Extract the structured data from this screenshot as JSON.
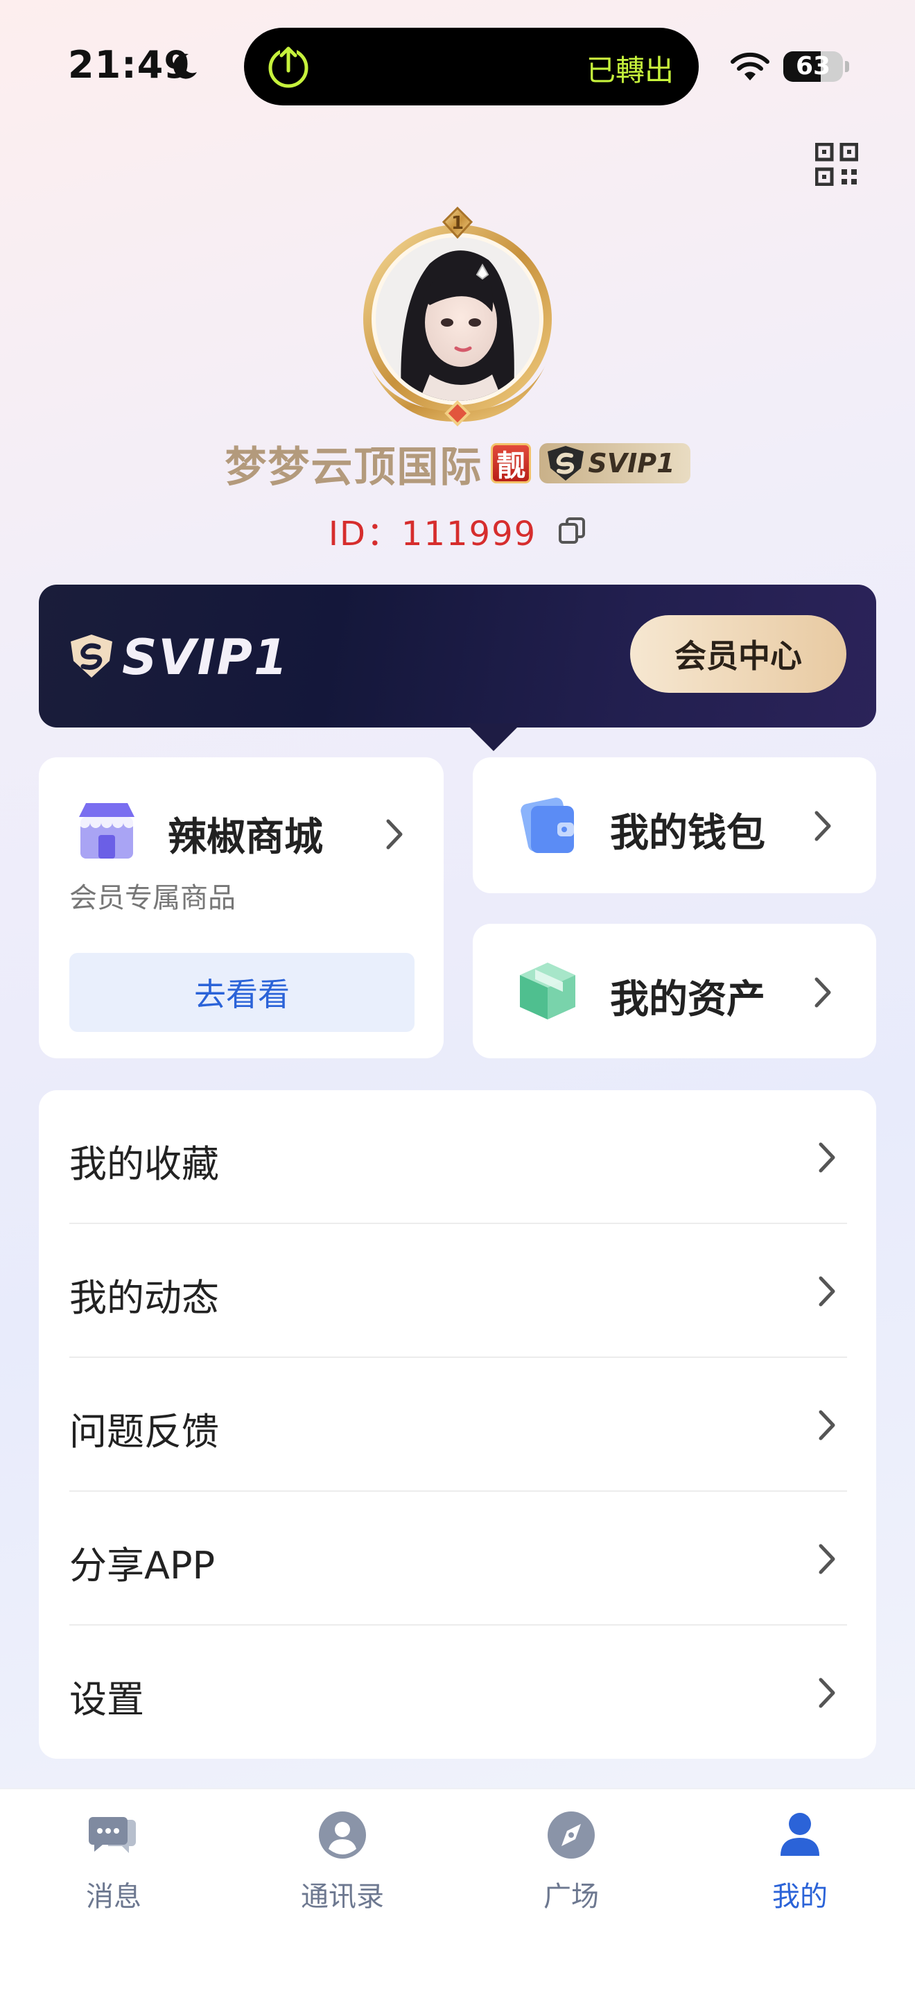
{
  "status_bar": {
    "time": "21:49",
    "island_text": "已轉出",
    "battery_level": "63",
    "battery_fraction": 0.63
  },
  "profile": {
    "avatar_level": "1",
    "nickname": "梦梦云顶国际",
    "pretty_badge": "靓",
    "svip_tag": "SVIP1",
    "id_text": "ID：111999"
  },
  "banner": {
    "title": "SVIP1",
    "vip_center_label": "会员中心"
  },
  "shop": {
    "title": "辣椒商城",
    "subtitle": "会员专属商品",
    "go_label": "去看看"
  },
  "wallet": {
    "title": "我的钱包"
  },
  "assets": {
    "title": "我的资产"
  },
  "menu": {
    "items": [
      {
        "label": "我的收藏"
      },
      {
        "label": "我的动态"
      },
      {
        "label": "问题反馈"
      },
      {
        "label": "分享APP"
      },
      {
        "label": "设置"
      }
    ]
  },
  "tabs": [
    {
      "label": "消息",
      "icon": "chat-icon"
    },
    {
      "label": "通讯录",
      "icon": "contacts-icon"
    },
    {
      "label": "广场",
      "icon": "compass-icon"
    },
    {
      "label": "我的",
      "icon": "person-icon",
      "active": true
    }
  ],
  "colors": {
    "accent": "#2b63d8",
    "id_red": "#d62d2d",
    "banner_dark": "#14173a",
    "gold": "#e8caa2"
  }
}
